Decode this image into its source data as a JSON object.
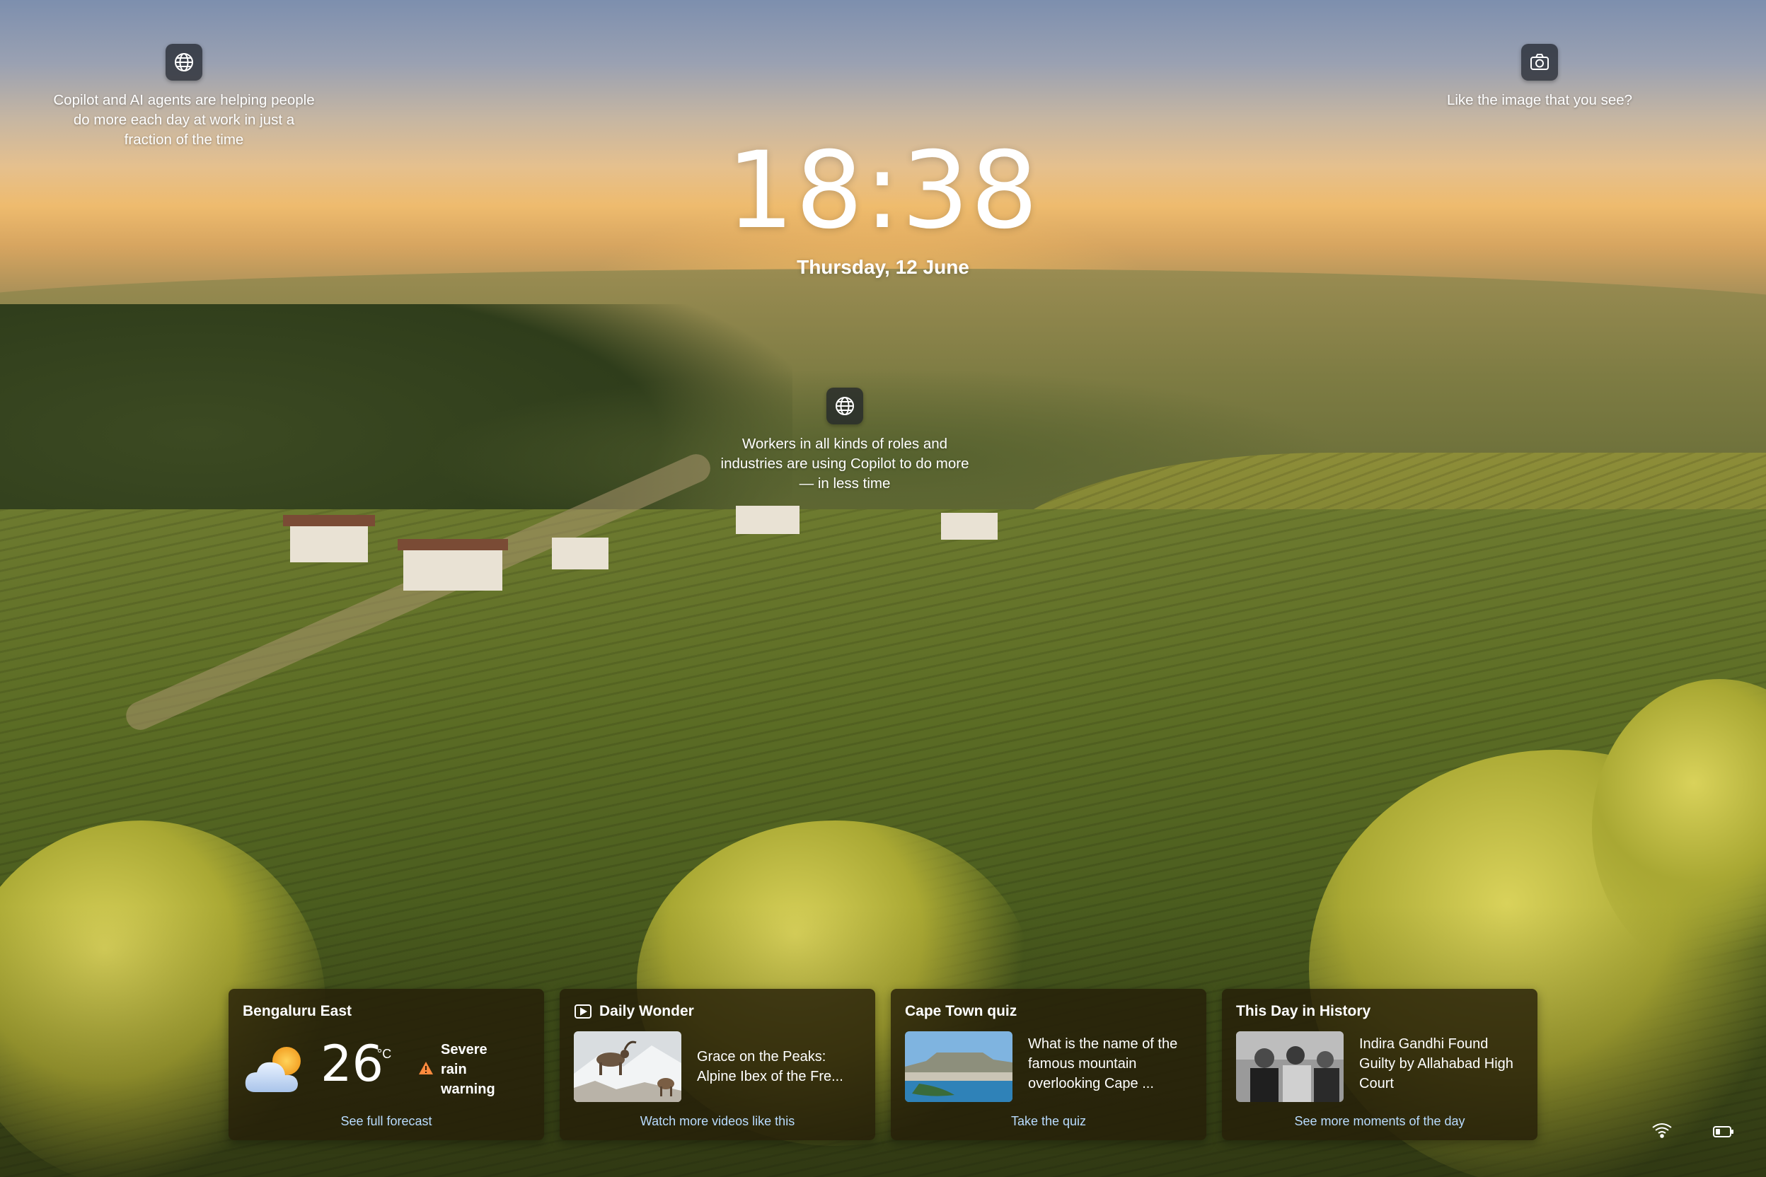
{
  "lock_screen": {
    "time": "18:38",
    "date": "Thursday, 12 June"
  },
  "spotlights": {
    "left": {
      "icon": "globe-icon",
      "text": "Copilot and AI agents are helping people\ndo more each day at work in just a\nfraction of the time"
    },
    "right": {
      "icon": "camera-icon",
      "text": "Like the image that you see?"
    },
    "center": {
      "icon": "globe-icon",
      "text": "Workers in all kinds of roles and\nindustries are using Copilot to do more\n— in less time"
    }
  },
  "widgets": {
    "weather": {
      "location": "Bengaluru East",
      "temperature": "26",
      "unit": "°C",
      "condition_icon": "partly-cloudy-icon",
      "alert": "Severe\nrain\nwarning",
      "link": "See full forecast"
    },
    "daily_wonder": {
      "title": "Daily Wonder",
      "icon": "video-icon",
      "headline": "Grace on the Peaks:\nAlpine Ibex of the Fre...",
      "link": "Watch more videos like this"
    },
    "quiz": {
      "title": "Cape Town quiz",
      "question": "What is the name of the\nfamous mountain\noverlooking Cape ...",
      "link": "Take the quiz"
    },
    "history": {
      "title": "This Day in History",
      "headline": "Indira Gandhi Found\nGuilty by Allahabad High\nCourt",
      "link": "See more moments of the day"
    }
  },
  "system_tray": {
    "wifi_icon": "wifi-icon",
    "battery_icon": "battery-icon"
  },
  "colors": {
    "card_bg": "#261e08",
    "link": "#b9dcff",
    "alert": "#ff8a3d"
  }
}
